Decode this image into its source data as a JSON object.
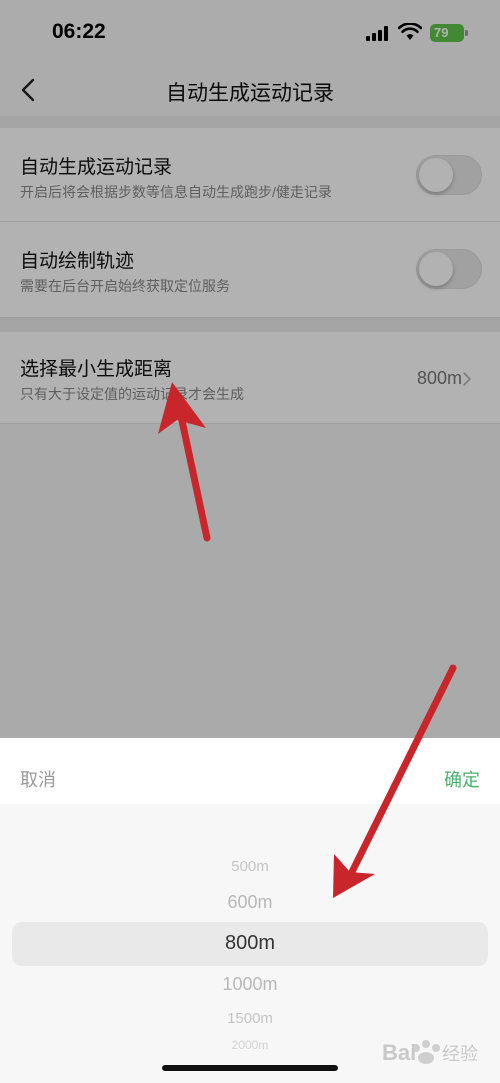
{
  "status_bar": {
    "time": "06:22",
    "battery": "79"
  },
  "nav": {
    "title": "自动生成运动记录"
  },
  "settings": {
    "auto_generate": {
      "title": "自动生成运动记录",
      "subtitle": "开启后将会根据步数等信息自动生成跑步/健走记录",
      "enabled": false
    },
    "auto_track": {
      "title": "自动绘制轨迹",
      "subtitle": "需要在后台开启始终获取定位服务",
      "enabled": false
    },
    "min_distance": {
      "title": "选择最小生成距离",
      "subtitle": "只有大于设定值的运动记录才会生成",
      "value": "800m"
    }
  },
  "sheet": {
    "cancel_label": "取消",
    "confirm_label": "确定",
    "options": [
      "500m",
      "600m",
      "800m",
      "1000m",
      "1500m",
      "2000m"
    ],
    "selected": "800m"
  },
  "colors": {
    "accent": "#4caf6a",
    "arrow": "#c8262b",
    "battery": "#5ec64a"
  }
}
